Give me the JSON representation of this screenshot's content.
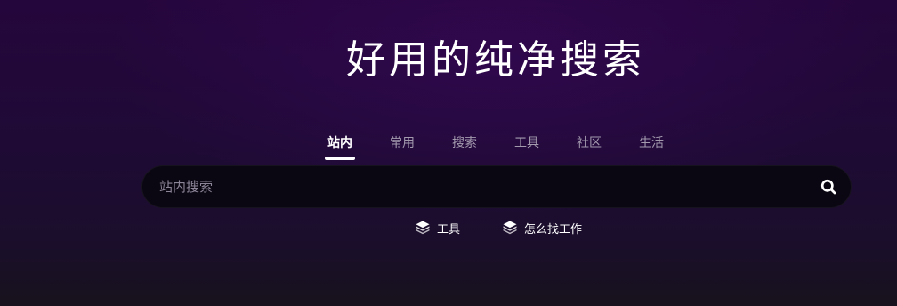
{
  "hero": {
    "title": "好用的纯净搜索"
  },
  "tabs": [
    {
      "label": "站内",
      "active": true
    },
    {
      "label": "常用",
      "active": false
    },
    {
      "label": "搜索",
      "active": false
    },
    {
      "label": "工具",
      "active": false
    },
    {
      "label": "社区",
      "active": false
    },
    {
      "label": "生活",
      "active": false
    }
  ],
  "search": {
    "placeholder": "站内搜索",
    "value": "",
    "button_icon": "search-icon"
  },
  "quick_links": [
    {
      "label": "工具",
      "icon": "layers-icon"
    },
    {
      "label": "怎么找工作",
      "icon": "layers-icon"
    }
  ],
  "colors": {
    "background_top": "#25063c",
    "background_bottom": "#17121d",
    "search_box": "#0b0712",
    "tab_inactive": "#a39aae",
    "tab_active": "#ffffff"
  }
}
